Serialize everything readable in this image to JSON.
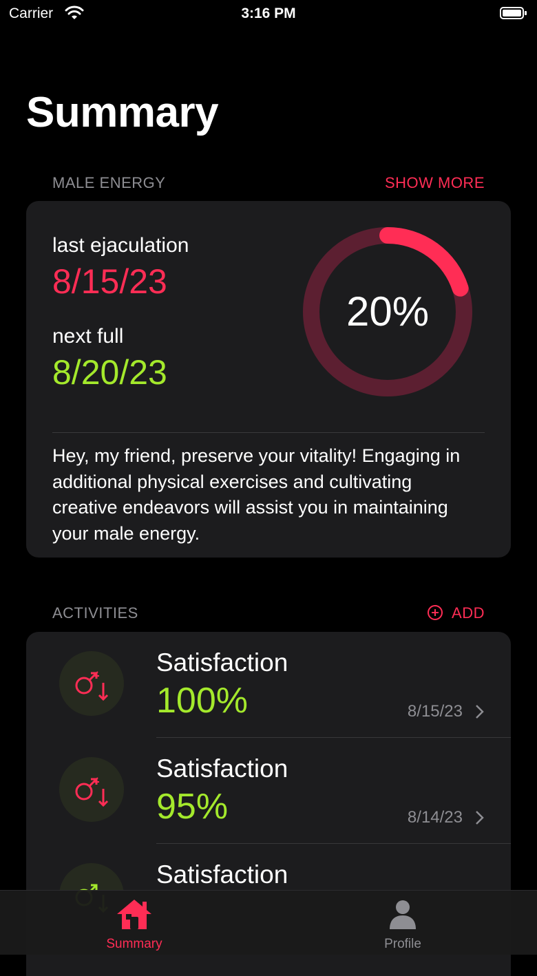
{
  "status_bar": {
    "carrier": "Carrier",
    "time": "3:16 PM"
  },
  "page": {
    "title": "Summary"
  },
  "male_energy": {
    "section_label": "MALE ENERGY",
    "action_label": "SHOW MORE",
    "last_label": "last ejaculation",
    "last_date": "8/15/23",
    "next_label": "next full",
    "next_date": "8/20/23",
    "percent_text": "20%",
    "progress": 0.2,
    "advice": "Hey, my friend, preserve your vitality! Engaging in additional physical exercises and cultivating creative endeavors will assist you in maintaining your male energy."
  },
  "activities": {
    "section_label": "ACTIVITIES",
    "add_label": "ADD",
    "items": [
      {
        "title": "Satisfaction",
        "value": "100%",
        "date": "8/15/23"
      },
      {
        "title": "Satisfaction",
        "value": "95%",
        "date": "8/14/23"
      },
      {
        "title": "Satisfaction",
        "value": "",
        "date": ""
      }
    ]
  },
  "tabbar": {
    "tabs": [
      {
        "label": "Summary",
        "icon": "house-icon",
        "selected": true
      },
      {
        "label": "Profile",
        "icon": "person-icon",
        "selected": false
      }
    ]
  },
  "colors": {
    "accent_red": "#ff2d55",
    "accent_green": "#a4e92c",
    "card_bg": "#1c1c1e",
    "muted": "#8e8e93"
  }
}
